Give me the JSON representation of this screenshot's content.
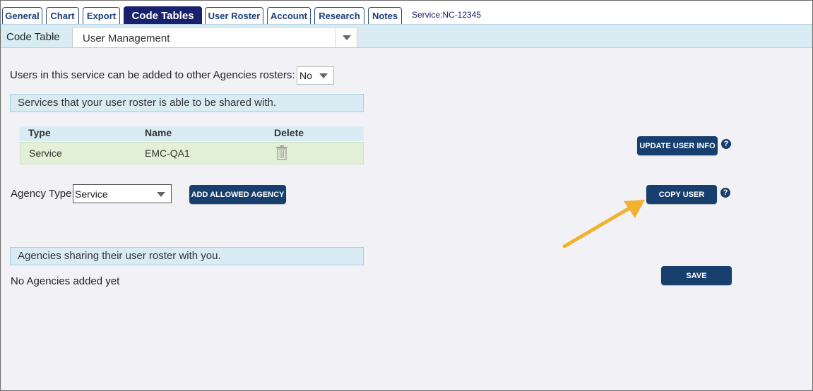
{
  "tabs": [
    {
      "label": "General"
    },
    {
      "label": "Chart"
    },
    {
      "label": "Export"
    },
    {
      "label": "Code Tables",
      "active": true
    },
    {
      "label": "User Roster"
    },
    {
      "label": "Account"
    },
    {
      "label": "Research"
    },
    {
      "label": "Notes"
    }
  ],
  "service_id": "Service:NC-12345",
  "code_table": {
    "label": "Code Table",
    "selected": "User Management"
  },
  "share_question": {
    "label": "Users in this service can be added to other Agencies rosters:",
    "value": "No"
  },
  "shared_with": {
    "header": "Services that your user roster is able to be shared with.",
    "columns": [
      "Type",
      "Name",
      "Delete"
    ],
    "rows": [
      {
        "type": "Service",
        "name": "EMC-QA1"
      }
    ]
  },
  "agency_type": {
    "label": "Agency Type:",
    "value": "Service"
  },
  "buttons": {
    "add_allowed_agency": "ADD ALLOWED AGENCY",
    "update_user_info": "UPDATE USER INFO",
    "copy_user": "COPY USER",
    "save": "SAVE"
  },
  "help_glyph": "?",
  "sharing_with_you": {
    "header": "Agencies sharing their user roster with you.",
    "empty_text": "No Agencies added yet"
  },
  "colors": {
    "tab_active": "#18216b",
    "button": "#173f6e",
    "section_bg": "#d9ecf4",
    "row_bg": "#e3f0d8",
    "arrow": "#f2b12e"
  },
  "icons": {
    "delete": "trash-icon",
    "help": "help-circle-icon",
    "dropdown": "caret-down-icon",
    "annotation": "arrow-icon"
  }
}
